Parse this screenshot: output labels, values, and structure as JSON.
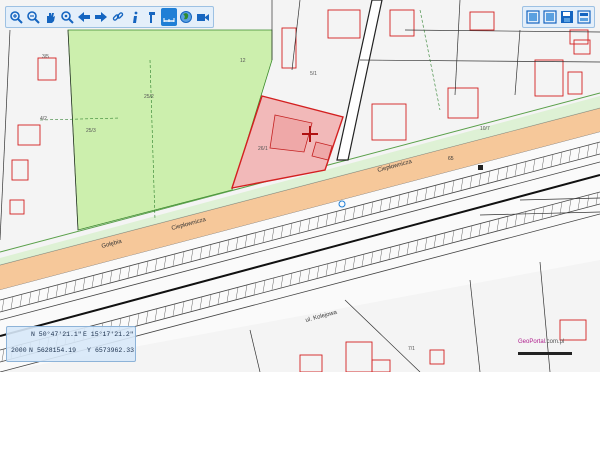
{
  "map": {
    "toolbar_left": [
      {
        "icon": "zoom-in-icon",
        "name": "zoom-in-tool"
      },
      {
        "icon": "zoom-out-icon",
        "name": "zoom-out-tool"
      },
      {
        "icon": "pan-hand-icon",
        "name": "pan-tool"
      },
      {
        "icon": "zoom-extent-icon",
        "name": "zoom-extent-tool"
      },
      {
        "icon": "arrow-left-icon",
        "name": "previous-view-tool"
      },
      {
        "icon": "arrow-right-icon",
        "name": "next-view-tool"
      },
      {
        "icon": "link-icon",
        "name": "link-tool"
      },
      {
        "icon": "info-icon",
        "name": "info-tool"
      },
      {
        "icon": "legend-icon",
        "name": "legend-tool"
      },
      {
        "icon": "measure-icon",
        "name": "measure-tool",
        "active": true
      },
      {
        "icon": "globe-icon",
        "name": "globe-tool"
      },
      {
        "icon": "video-camera-icon",
        "name": "video-tool"
      }
    ],
    "toolbar_right": [
      {
        "icon": "layout-panel-icon",
        "name": "layout-tool-1"
      },
      {
        "icon": "layout-panel-icon",
        "name": "layout-tool-2"
      },
      {
        "icon": "save-map-icon",
        "name": "save-map-tool"
      },
      {
        "icon": "print-icon",
        "name": "print-tool"
      }
    ],
    "colors": {
      "accent": "#1f7fd6",
      "road_fill": "#f6c89a",
      "green_area": "#ccefad",
      "selected_parcel": "#f2b9b9",
      "building_outline": "#d32020",
      "parcel_line": "#333333"
    },
    "coords": {
      "lat_n": "N 50°47'21.1\"",
      "lon_e": "E 15°17'21.2\"",
      "srs": "2000",
      "n_label": "N",
      "n_value": "5628154.19",
      "y_label": "Y",
      "y_value": "6573962.33"
    },
    "logo": {
      "brand": "GeoPortal",
      "suffix": ".com.pl"
    },
    "labels": {
      "road_upper": "Ciepłownicza",
      "road_lower": "Ciepłownicza",
      "street_left": "Gołębia",
      "street_bottom": "ul. Kolejowa",
      "green_parcel_1": "25/2",
      "green_parcel_2": "25/3",
      "selected_parcel": "26/1",
      "parcel_a": "3/5",
      "parcel_b": "4/2",
      "parcel_c": "5/1",
      "parcel_d": "10/7",
      "parcel_e": "12",
      "parcel_f": "7/1",
      "house_no": "65"
    }
  }
}
